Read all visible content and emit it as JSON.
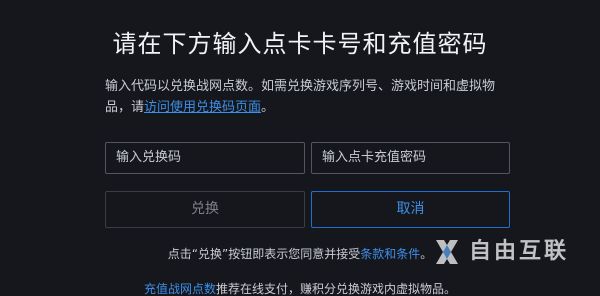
{
  "dialog": {
    "title": "请在下方输入点卡卡号和充值密码",
    "description": {
      "text_before": "输入代码以兑换战网点数。如需兑换游戏序列号、游戏时间和虚拟物品，请",
      "link_text": "访问使用兑换码页面",
      "text_after": "。"
    },
    "inputs": {
      "code_placeholder": "输入兑换码",
      "pin_placeholder": "输入点卡充值密码"
    },
    "buttons": {
      "redeem_label": "兑换",
      "cancel_label": "取消"
    },
    "terms": {
      "text_before": "点击“兑换”按钮即表示您同意并接受",
      "link_text": "条款和条件",
      "text_after": "。"
    },
    "promo": {
      "link_text": "充值战网点数",
      "text_after": "推荐在线支付，赚积分兑换游戏内虚拟物品。"
    }
  },
  "watermark": {
    "text": "自由互联",
    "icon": "x-logo-icon"
  },
  "colors": {
    "background": "#15171d",
    "accent": "#3d8fe8",
    "text": "#c9ccd3",
    "disabled": "#7d818a"
  }
}
